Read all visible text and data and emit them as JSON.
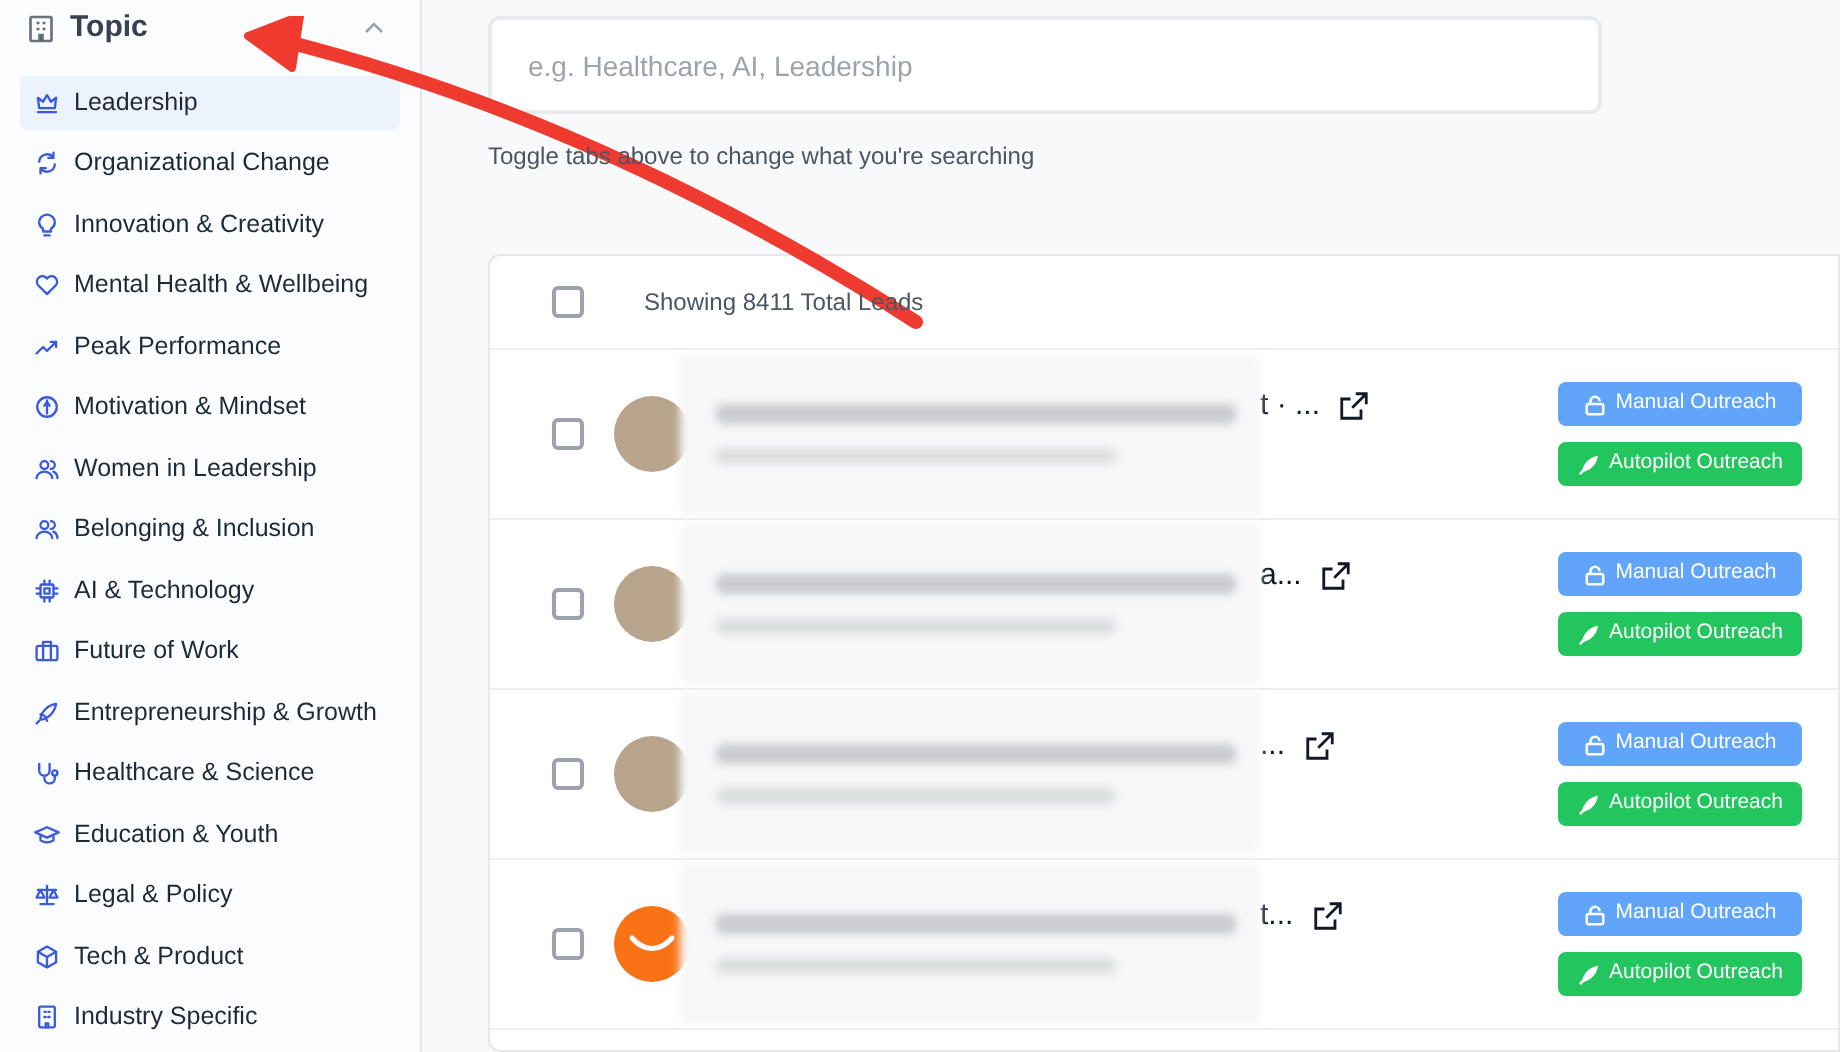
{
  "sidebar": {
    "section_title": "Topic",
    "expanded": true,
    "items": [
      {
        "label": "Leadership",
        "selected": true
      },
      {
        "label": "Organizational Change",
        "selected": false
      },
      {
        "label": "Innovation & Creativity",
        "selected": false
      },
      {
        "label": "Mental Health & Wellbeing",
        "selected": false
      },
      {
        "label": "Peak Performance",
        "selected": false
      },
      {
        "label": "Motivation & Mindset",
        "selected": false
      },
      {
        "label": "Women in Leadership",
        "selected": false
      },
      {
        "label": "Belonging & Inclusion",
        "selected": false
      },
      {
        "label": "AI & Technology",
        "selected": false
      },
      {
        "label": "Future of Work",
        "selected": false
      },
      {
        "label": "Entrepreneurship & Growth",
        "selected": false
      },
      {
        "label": "Healthcare & Science",
        "selected": false
      },
      {
        "label": "Education & Youth",
        "selected": false
      },
      {
        "label": "Legal & Policy",
        "selected": false
      },
      {
        "label": "Tech & Product",
        "selected": false
      },
      {
        "label": "Industry Specific",
        "selected": false
      }
    ]
  },
  "search": {
    "placeholder": "e.g. Healthcare, AI, Leadership",
    "hint": "Toggle tabs above to change what you're searching"
  },
  "table": {
    "header": "Showing 8411 Total Leads",
    "select_all_checked": false,
    "rows": [
      {
        "name_tail": "t · ...",
        "kind": "photo",
        "checked": false,
        "buttons": [
          "Manual Outreach",
          "Autopilot Outreach"
        ]
      },
      {
        "name_tail": "a...",
        "kind": "photo",
        "checked": false,
        "buttons": [
          "Manual Outreach",
          "Autopilot Outreach"
        ]
      },
      {
        "name_tail": "...",
        "kind": "photo",
        "checked": false,
        "buttons": [
          "Manual Outreach",
          "Autopilot Outreach"
        ]
      },
      {
        "name_tail": "t...",
        "kind": "logo",
        "checked": false,
        "buttons": [
          "Manual Outreach",
          "Autopilot Outreach"
        ]
      }
    ]
  }
}
